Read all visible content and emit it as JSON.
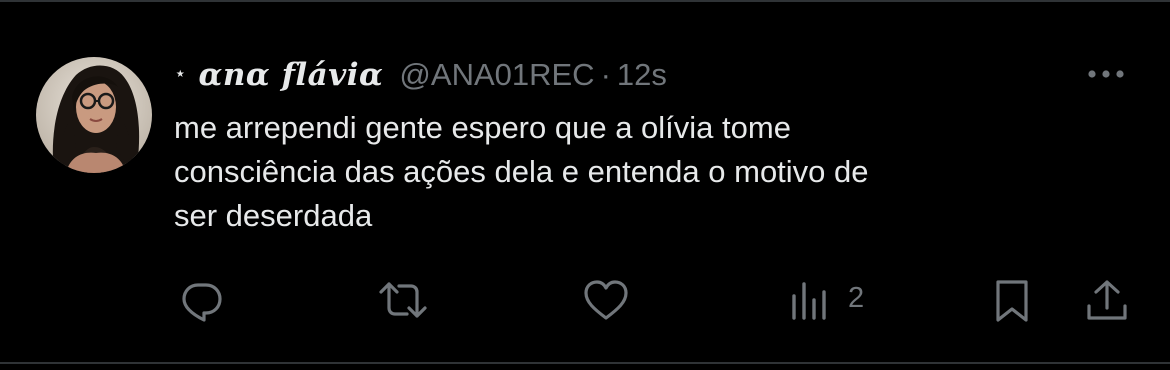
{
  "tweet": {
    "author": {
      "badge_glyph": "⋆",
      "display_name": "ɑnɑ fláviɑ",
      "handle": "@ANA01REC",
      "separator": "·",
      "time": "12s"
    },
    "text_lines": [
      "me arrependi gente espero que a olívia tome",
      "consciência das ações dela e entenda o motivo de",
      "ser deserdada"
    ],
    "actions": {
      "views_count": "2"
    }
  },
  "icons": {
    "more": "more-horizontal-icon",
    "reply": "reply-bubble-icon",
    "retweet": "retweet-icon",
    "like": "heart-icon",
    "views": "views-bar-chart-icon",
    "bookmark": "bookmark-icon",
    "share": "share-upload-icon"
  },
  "colors": {
    "background": "#000000",
    "text_primary": "#e7e9ea",
    "text_secondary": "#71767b",
    "divider": "#2f3336"
  }
}
